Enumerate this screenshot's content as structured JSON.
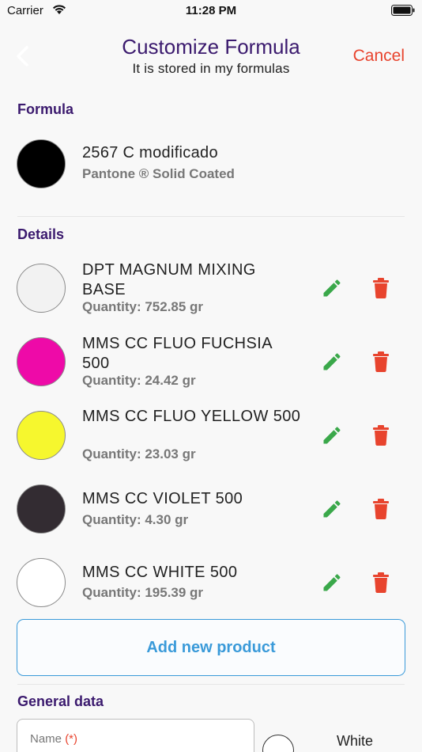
{
  "status_bar": {
    "carrier": "Carrier",
    "time": "11:28 PM"
  },
  "header": {
    "title": "Customize Formula",
    "subtitle": "It is stored in my formulas",
    "cancel_label": "Cancel"
  },
  "formula": {
    "section_title": "Formula",
    "name": "2567 C modificado",
    "library": "Pantone ® Solid Coated",
    "color": "#000000"
  },
  "details": {
    "section_title": "Details",
    "items": [
      {
        "name": "DPT MAGNUM MIXING BASE",
        "quantity": "Quantity: 752.85 gr",
        "color": "#f2f2f2"
      },
      {
        "name": "MMS CC FLUO FUCHSIA 500",
        "quantity": "Quantity: 24.42 gr",
        "color": "#ee0aa8"
      },
      {
        "name": "MMS CC FLUO YELLOW 500",
        "quantity": "Quantity: 23.03 gr",
        "color": "#f6f72e"
      },
      {
        "name": "MMS CC VIOLET 500",
        "quantity": "Quantity: 4.30 gr",
        "color": "#332c32"
      },
      {
        "name": "MMS CC WHITE 500",
        "quantity": "Quantity: 195.39 gr",
        "color": "#ffffff"
      }
    ],
    "add_button_label": "Add new product"
  },
  "general_data": {
    "section_title": "General data",
    "name_label": "Name",
    "name_required": "(*)",
    "white_label": "White"
  },
  "colors": {
    "accent_purple": "#3b1a6e",
    "cancel_red": "#e8442e",
    "edit_green": "#3aa84a",
    "delete_red": "#e8442e",
    "button_blue": "#3a9ad9"
  },
  "icons": {
    "back": "chevron-left-icon",
    "edit": "pencil-icon",
    "delete": "trash-icon"
  }
}
